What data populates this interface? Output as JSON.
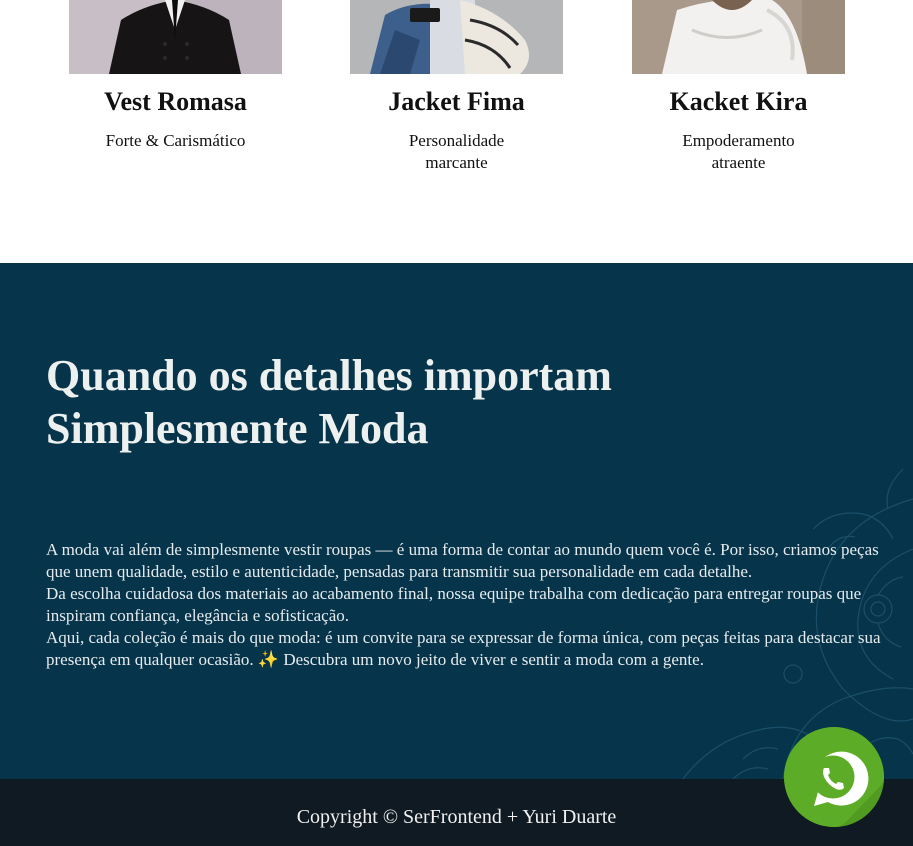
{
  "products": [
    {
      "name": "Vest Romasa",
      "description": "Forte & Carismático"
    },
    {
      "name": "Jacket Fima",
      "description": "Personalidade marcante"
    },
    {
      "name": "Kacket Kira",
      "description": "Empoderamento atraente"
    }
  ],
  "about": {
    "title_line1": "Quando os detalhes importam",
    "title_line2": "Simplesmente Moda",
    "paragraphs": [
      "A moda vai além de simplesmente vestir roupas — é uma forma de contar ao mundo quem você é. Por isso, criamos peças que unem qualidade, estilo e autenticidade, pensadas para transmitir sua personalidade em cada detalhe.",
      "Da escolha cuidadosa dos materiais ao acabamento final, nossa equipe trabalha com dedicação para entregar roupas que inspiram confiança, elegância e sofisticação.",
      "Aqui, cada coleção é mais do que moda: é um convite para se expressar de forma única, com peças feitas para destacar sua presença em qualquer ocasião. ✨ Descubra um novo jeito de viver e sentir a moda com a gente."
    ]
  },
  "footer": {
    "copyright": "Copyright © SerFrontend + Yuri Duarte"
  },
  "whatsapp": {
    "icon": "whatsapp-icon"
  },
  "colors": {
    "about_bg": "#06344a",
    "footer_bg": "#0f1a22",
    "whatsapp_green": "#5dac27"
  }
}
